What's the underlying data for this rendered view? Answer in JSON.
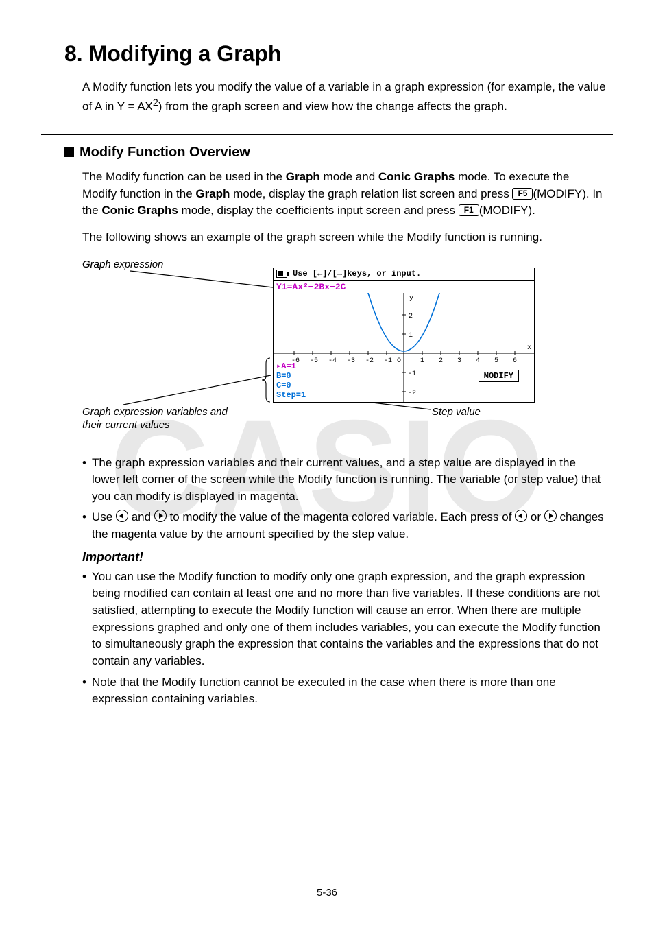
{
  "heading": "8. Modifying a Graph",
  "intro_a": "A Modify function lets you modify the value of a variable in a graph expression (for example, the value of A in Y = AX",
  "intro_sup": "2",
  "intro_b": ") from the graph screen and view how the change affects the graph.",
  "sub_heading": "Modify Function Overview",
  "p1_a": "The Modify function can be used in the ",
  "p1_graph": "Graph",
  "p1_b": " mode and ",
  "p1_conic": "Conic Graphs",
  "p1_c": " mode. To execute the Modify function in the ",
  "p1_d": " mode, display the graph relation list screen and press ",
  "key_f5": "F5",
  "p1_e": "(MODIFY). In the ",
  "p1_f": " mode, display the coefficients input screen and press ",
  "key_f1": "F1",
  "p1_g": "(MODIFY).",
  "p2": "The following shows an example of the graph screen while the Modify function is running.",
  "labels": {
    "graph_expression": "Graph expression",
    "graph": "Graph",
    "vars_a": "Graph expression variables and",
    "vars_b": "their current values",
    "step_value": "Step value"
  },
  "screen": {
    "header_text": "Use [←]/[→]keys, or input.",
    "expr": "Y1=Ax²−2Bx−2C",
    "var_a": "▸A=1",
    "var_b": "B=0",
    "var_c": "C=0",
    "step": "Step=1",
    "modify": "MODIFY"
  },
  "bullets": {
    "b1": "The graph expression variables and their current values, and a step value are displayed in the lower left corner of the screen while the Modify function is running. The variable (or step value) that you can modify is displayed in magenta.",
    "b2_a": "Use ",
    "b2_b": " and ",
    "b2_c": " to modify the value of the magenta colored variable. Each press of ",
    "b2_d": " or ",
    "b2_e": " changes the magenta value by the amount specified by the step value."
  },
  "important": "Important!",
  "bullets2": {
    "b1": "You can use the Modify function to modify only one graph expression, and the graph expression being modified can contain at least one and no more than five variables. If these conditions are not satisfied, attempting to execute the Modify function will cause an error. When there are multiple expressions graphed and only one of them includes variables, you can execute the Modify function to simultaneously graph the expression that contains the variables and the expressions that do not contain any variables.",
    "b2": "Note that the Modify function cannot be executed in the case when there is more than one expression containing variables."
  },
  "page_number": "5-36"
}
